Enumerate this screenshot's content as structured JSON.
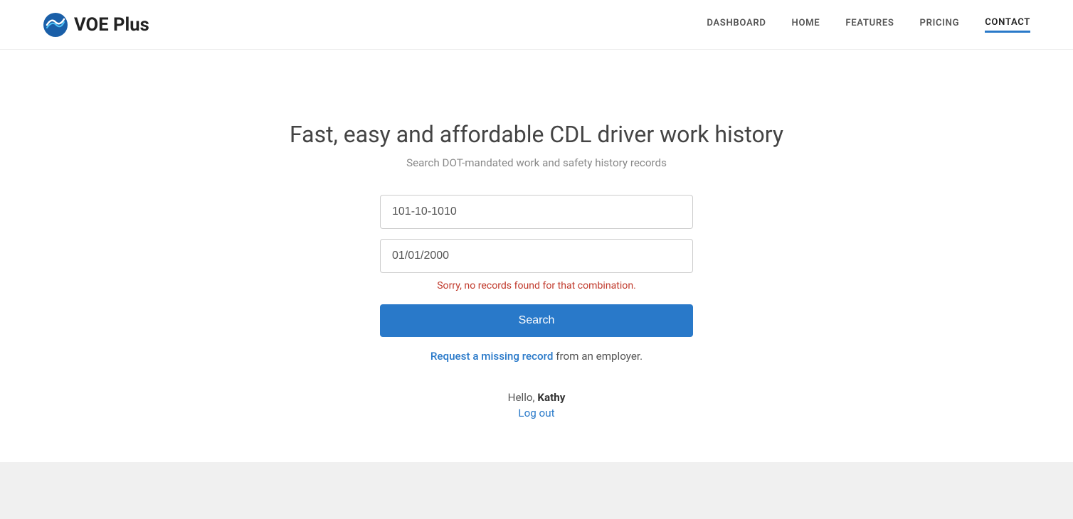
{
  "brand": {
    "logo_text": "VOE Plus"
  },
  "nav": {
    "links": [
      {
        "label": "DASHBOARD",
        "active": false
      },
      {
        "label": "HOME",
        "active": false
      },
      {
        "label": "FEATURES",
        "active": false
      },
      {
        "label": "PRICING",
        "active": false
      },
      {
        "label": "CONTACT",
        "active": true
      }
    ]
  },
  "hero": {
    "title": "Fast, easy and affordable CDL driver work history",
    "subtitle": "Search DOT-mandated work and safety history records"
  },
  "search": {
    "ssn_placeholder": "101-10-1010",
    "ssn_value": "101-10-1010",
    "dob_placeholder": "01/01/2000",
    "dob_value": "01/01/2000",
    "error_message": "Sorry, no records found for that combination.",
    "button_label": "Search"
  },
  "missing_record": {
    "link_text": "Request a missing record",
    "suffix_text": " from an employer."
  },
  "user": {
    "greeting": "Hello, ",
    "name": "Kathy",
    "logout_label": "Log out"
  }
}
